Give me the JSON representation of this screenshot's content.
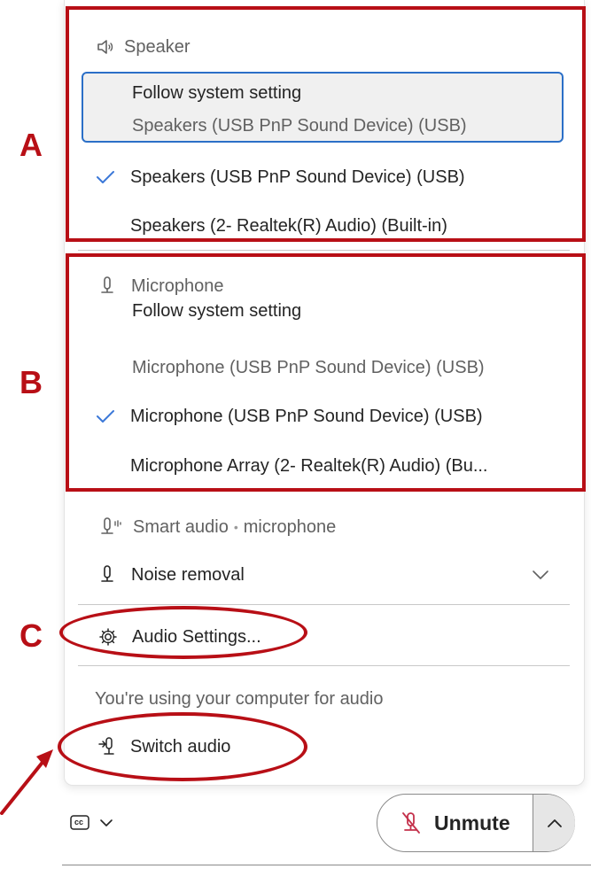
{
  "speaker": {
    "header": "Speaker",
    "follow_title": "Follow system setting",
    "follow_device": "Speakers (USB PnP Sound Device) (USB)",
    "options": [
      "Speakers (USB PnP Sound Device) (USB)",
      "Speakers (2- Realtek(R) Audio) (Built-in)"
    ],
    "selected_index": 0
  },
  "microphone": {
    "header": "Microphone",
    "follow_title": "Follow system setting",
    "follow_device": "Microphone (USB PnP Sound Device) (USB)",
    "options": [
      "Microphone (USB PnP Sound Device) (USB)",
      "Microphone Array (2- Realtek(R) Audio) (Bu..."
    ],
    "selected_index": 0
  },
  "smart_audio": {
    "label": "Smart audio",
    "separator": "•",
    "value": "microphone",
    "noise_removal": "Noise removal"
  },
  "audio_settings_label": "Audio Settings...",
  "status_text": "You're using your computer for audio",
  "switch_audio_label": "Switch audio",
  "bottom_bar": {
    "unmute_label": "Unmute",
    "captions_icon_text": "cc"
  },
  "annotations": {
    "a": "A",
    "b": "B",
    "c": "C"
  },
  "colors": {
    "accent_blue": "#2b6fc7",
    "annotation_red": "#b80f16",
    "muted_red": "#c4314b",
    "check_blue": "#3b78d8"
  }
}
